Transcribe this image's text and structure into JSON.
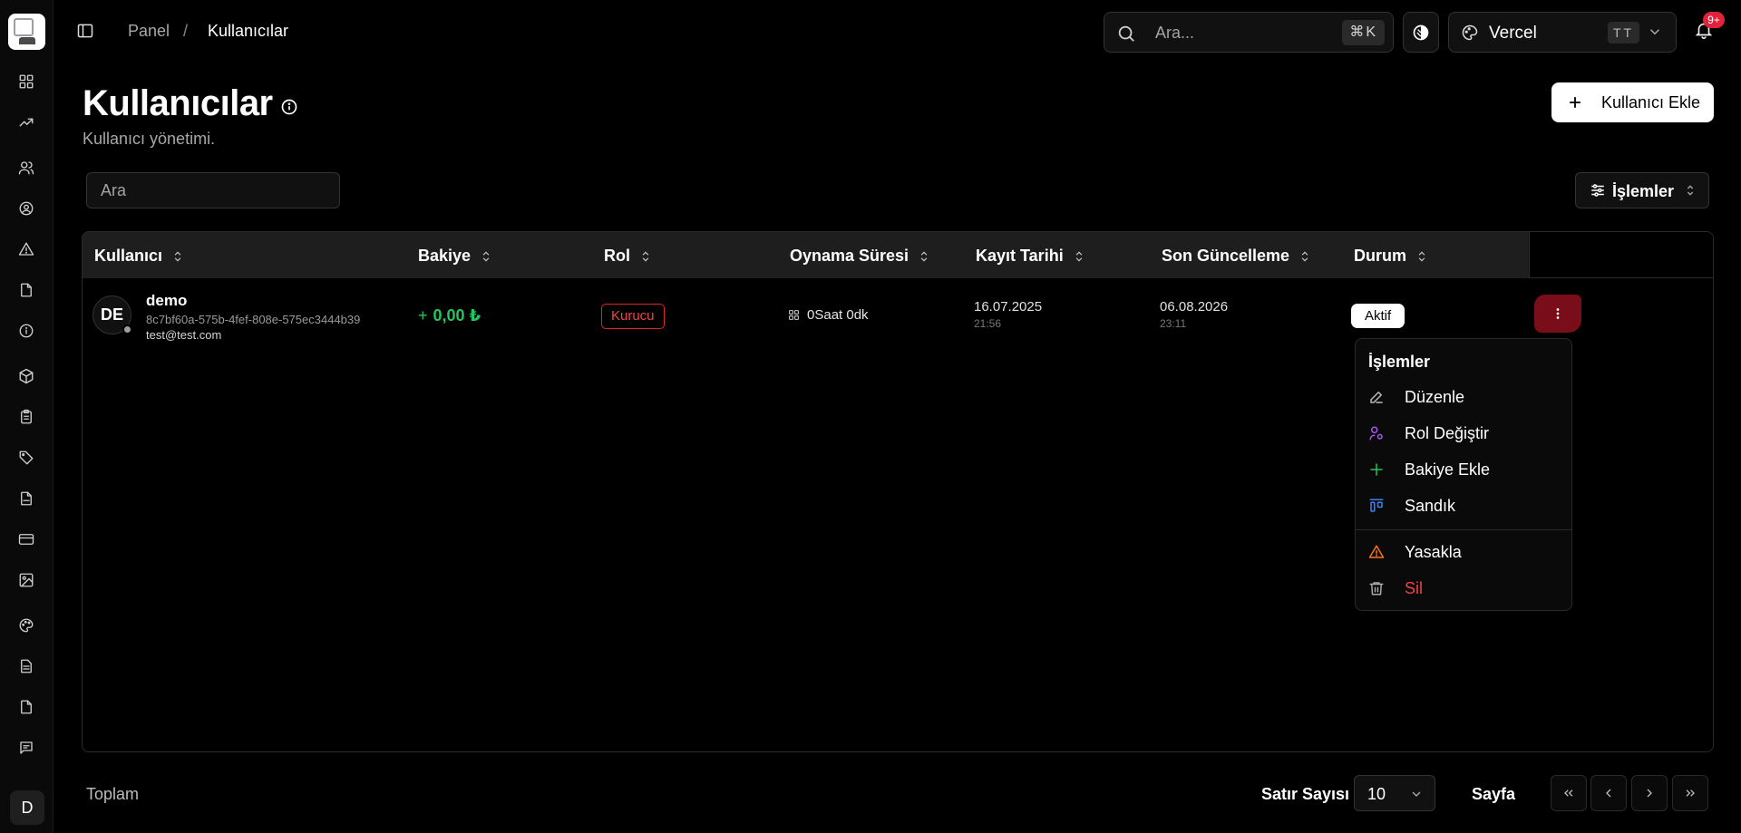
{
  "breadcrumb": {
    "parent": "Panel",
    "separator": "/",
    "current": "Kullanıcılar"
  },
  "search": {
    "placeholder": "Ara...",
    "shortcut": "⌘K"
  },
  "team": {
    "name": "Vercel",
    "badge": "TT"
  },
  "notifications": {
    "count": "9+"
  },
  "header": {
    "title": "Kullanıcılar",
    "subtitle": "Kullanıcı yönetimi.",
    "add_label": "Kullanıcı Ekle"
  },
  "filter": {
    "placeholder": "Ara"
  },
  "ops": {
    "label": "İşlemler"
  },
  "table": {
    "columns": [
      "Kullanıcı",
      "Bakiye",
      "Rol",
      "Oynama Süresi",
      "Kayıt Tarihi",
      "Son Güncelleme",
      "Durum"
    ],
    "rows": [
      {
        "initials": "DE",
        "name": "demo",
        "id": "8c7bf60a-575b-4fef-808e-575ec3444b39",
        "email": "test@test.com",
        "balance_prefix": "+",
        "balance": "0,00 ₺",
        "role": "Kurucu",
        "playtime": "0Saat 0dk",
        "created_date": "16.07.2025",
        "created_time": "21:56",
        "updated_date": "06.08.2026",
        "updated_time": "23:11",
        "status": "Aktif"
      }
    ]
  },
  "menu": {
    "title": "İşlemler",
    "items": [
      {
        "label": "Düzenle",
        "icon": "edit-icon",
        "color": "#ffffff"
      },
      {
        "label": "Rol Değiştir",
        "icon": "user-cog-icon",
        "color": "#ffffff"
      },
      {
        "label": "Bakiye Ekle",
        "icon": "plus-icon",
        "color": "#ffffff"
      },
      {
        "label": "Sandık",
        "icon": "chest-icon",
        "color": "#ffffff"
      },
      {
        "label": "Yasakla",
        "icon": "warning-icon",
        "color": "#ffffff"
      },
      {
        "label": "Sil",
        "icon": "trash-icon",
        "color": "#ef4444"
      }
    ]
  },
  "footer": {
    "total_label": "Toplam",
    "rows_label": "Satır Sayısı",
    "rows_value": "10",
    "page_label": "Sayfa"
  },
  "user": {
    "initial": "D"
  },
  "colors": {
    "accent_green": "#22c55e",
    "danger": "#ef4444",
    "purple": "#a855f7",
    "blue": "#3b82f6",
    "orange": "#f97316"
  }
}
